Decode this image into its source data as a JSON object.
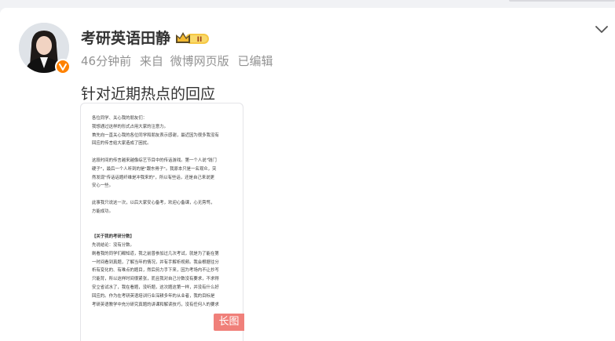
{
  "post": {
    "author": "考研英语田静",
    "badge_text": "II",
    "meta": {
      "time": "46分钟前",
      "from_label": "来自",
      "source": "微博网页版",
      "edited": "已编辑"
    },
    "text": "针对近期热点的回应",
    "long_image": {
      "tag": "长图",
      "lines": [
        "各位同学、关心我的朋友们：",
        "我想通过这样的形式占用大家的注意力。",
        "首先向一直关心我的各位同学和朋友表示感谢，最近因为很多我没有",
        "回应的传言给大家造成了困扰。",
        "",
        "这段时间的传言越来越像综艺节目中的传话游戏。第一个人说\"钱门",
        "硬子\"，最后一个人听到的是\"跟东骨子\"。我原本只是一名观众，突",
        "然发现\"传话话题纤维是冲我来的\"，所以有些话，还是自己来说更",
        "安心一些。",
        "",
        "此事我只说这一次，以后大家安心备考，欢迎心备课，心无旁骛，",
        "方能成功。",
        "",
        "",
        "【关于我的考研分数】",
        "先说结论：没有分数。",
        "刷看我的同学们都知道，我之前曾参加过几次考试，就是为了能在第",
        "一时间看到真题，了解当年的情况，并有手解析视频。我会根据往分",
        "析有变化的、有难点的题目，然后剪力手下来，因为考场内不让抄写",
        "只能背，所以这样时间很紧张，而且我对自己分数没有要求，不求得",
        "安立省试水了，我在看题，没听题，这次题这第一样，并没有什么好",
        "回应的。作为在考研英语培训行业深耕多年的从业者，我的目标是",
        "考研英语教学中充分研究真题的讲课和解读技巧，没有任何人的要求"
      ]
    }
  }
}
